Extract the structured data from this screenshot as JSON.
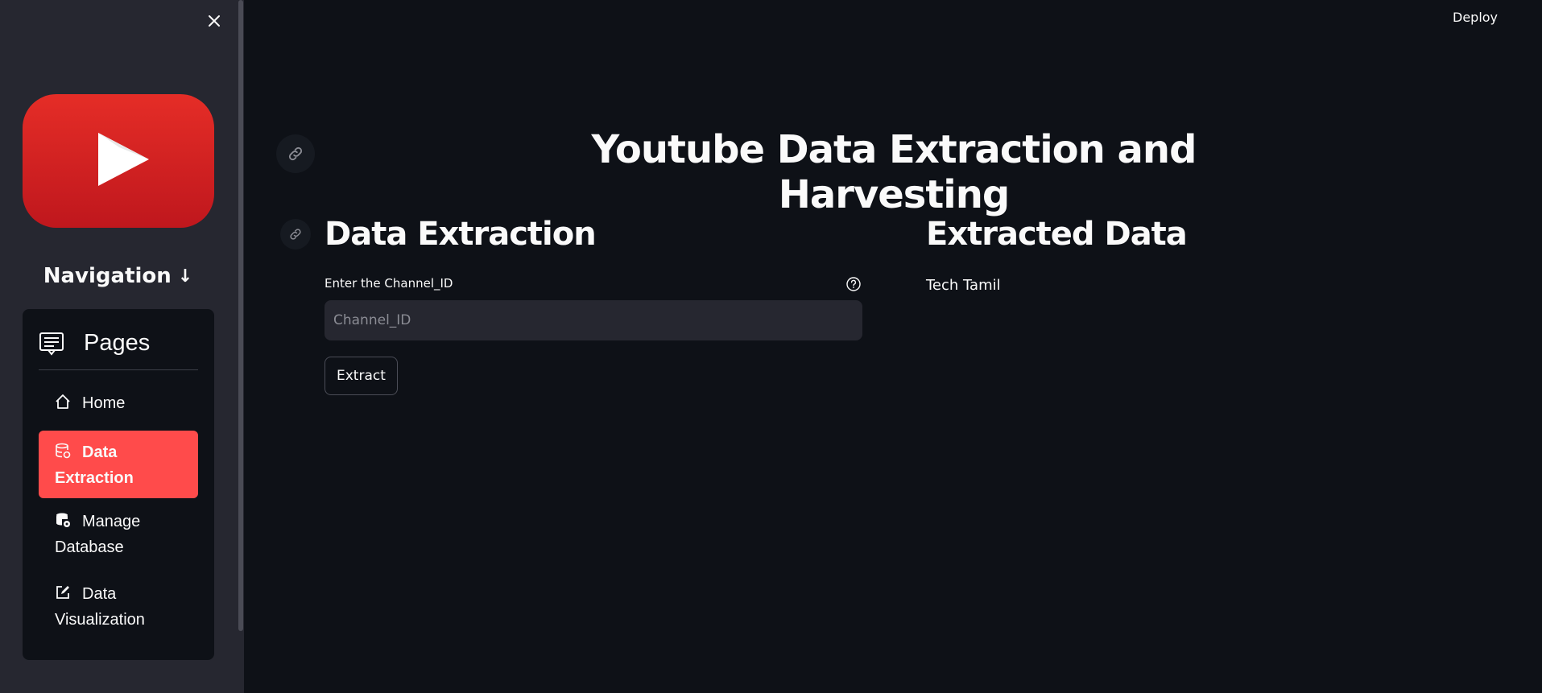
{
  "header": {
    "deploy_label": "Deploy"
  },
  "sidebar": {
    "navigation_heading": "Navigation",
    "navigation_arrow": "↓",
    "pages_title": "Pages",
    "items": [
      {
        "label": "Home",
        "icon": "home-icon",
        "active": false
      },
      {
        "label": "Data Extraction",
        "icon": "database-icon",
        "active": true
      },
      {
        "label": "Manage Database",
        "icon": "database-settings-icon",
        "active": false
      },
      {
        "label": "Data Visualization",
        "icon": "edit-icon",
        "active": false
      }
    ],
    "active_color": "#ff4b4b",
    "logo_icon": "youtube-logo"
  },
  "main": {
    "title": "Youtube Data Extraction and Harvesting",
    "left": {
      "heading": "Data Extraction",
      "field_label": "Enter the Channel_ID",
      "field_placeholder": "Channel_ID",
      "field_value": "",
      "button_label": "Extract"
    },
    "right": {
      "heading": "Extracted Data",
      "value": "Tech Tamil"
    }
  }
}
